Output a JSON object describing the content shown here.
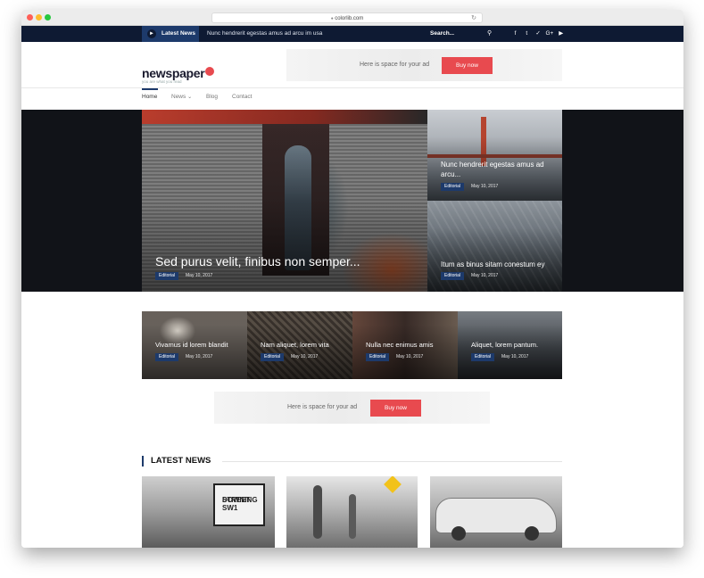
{
  "browser": {
    "url": "colorlib.com",
    "dot_colors": [
      "#ff5f57",
      "#febc2e",
      "#28c840"
    ],
    "reload_icon": "reload-icon"
  },
  "topbar": {
    "latest_label": "Latest News",
    "ticker_text": "Nunc hendrerit egestas amus ad arcu im usa",
    "search_label": "Search...",
    "social": [
      "f",
      "t",
      "✓",
      "G+",
      "▶"
    ]
  },
  "header": {
    "logo_text": "newspaper",
    "tagline": "you are what you read",
    "ad_text": "Here is space for your ad",
    "ad_button": "Buy now"
  },
  "nav": {
    "items": [
      "Home",
      "News",
      "Blog",
      "Contact"
    ],
    "news_caret": "⌄"
  },
  "hero": {
    "title": "Sed purus velit, finibus non semper...",
    "tag": "Editorial",
    "date": "May 10, 2017"
  },
  "side_cards": [
    {
      "title_line1": "Nunc hendrerit egestas amus ad",
      "title_line2": "arcu...",
      "tag": "Editorial",
      "date": "May 10, 2017"
    },
    {
      "title_line1": "Itum as binus sitam conestum ey",
      "title_line2": "",
      "tag": "Editorial",
      "date": "May 10, 2017"
    }
  ],
  "strip": [
    {
      "title": "Vivamus id lorem blandit",
      "tag": "Editorial",
      "date": "May 10, 2017"
    },
    {
      "title": "Nam aliquet, lorem vita",
      "tag": "Editorial",
      "date": "May 10, 2017"
    },
    {
      "title": "Nulla nec enimus amis",
      "tag": "Editorial",
      "date": "May 10, 2017"
    },
    {
      "title": "Aliquet, lorem pantum.",
      "tag": "Editorial",
      "date": "May 10, 2017"
    }
  ],
  "mid_ad": {
    "text": "Here is space for your ad",
    "button": "Buy now"
  },
  "latest_news": {
    "title": "LATEST NEWS",
    "sign_line1": "DOWNING",
    "sign_line2": "STREET SW1"
  },
  "colors": {
    "navy": "#0e1a33",
    "accent_blue": "#1d3a6b",
    "accent_red": "#e84a4f"
  }
}
